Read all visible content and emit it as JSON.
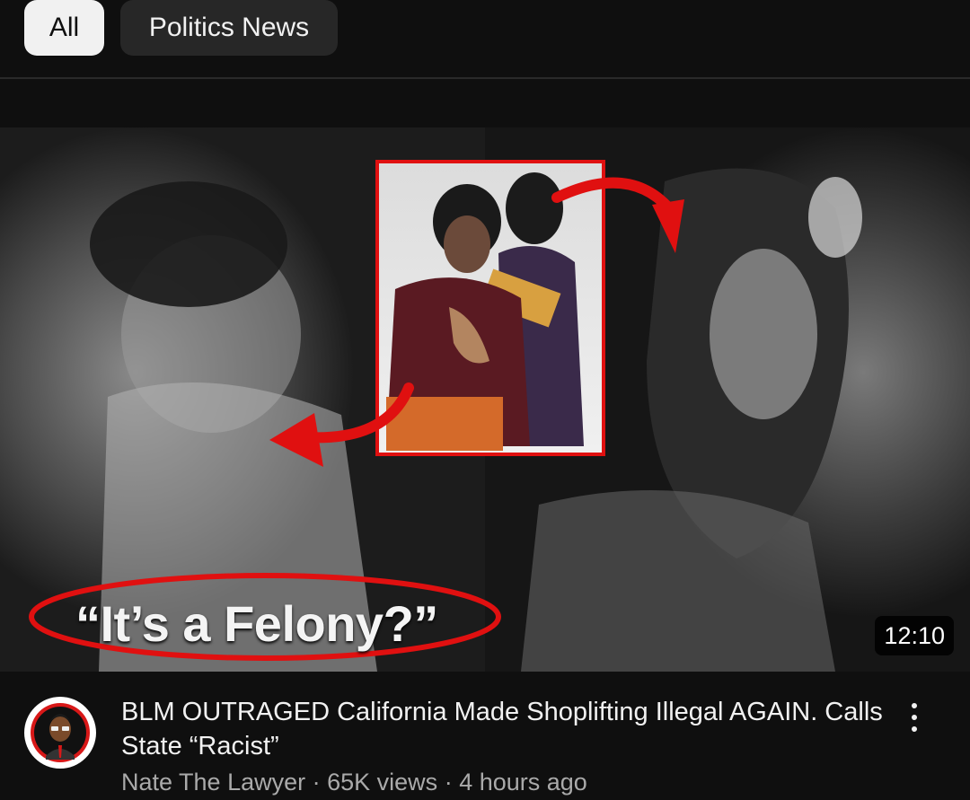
{
  "chips": [
    {
      "label": "All",
      "selected": true
    },
    {
      "label": "Politics News",
      "selected": false
    }
  ],
  "video": {
    "thumbnail_caption": "“It’s a Felony?”",
    "duration": "12:10",
    "title": "BLM OUTRAGED California Made Shoplifting Illegal AGAIN. Calls State “Racist”",
    "channel": "Nate The Lawyer",
    "views": "65K views",
    "age": "4 hours ago",
    "separator": " · "
  },
  "icons": {
    "menu": "more-vert-icon",
    "avatar": "channel-avatar"
  },
  "colors": {
    "background": "#0f0f0f",
    "chip_selected_bg": "#f1f1f1",
    "chip_bg": "#272727",
    "accent_red": "#e01010",
    "secondary_text": "#aaaaaa"
  }
}
